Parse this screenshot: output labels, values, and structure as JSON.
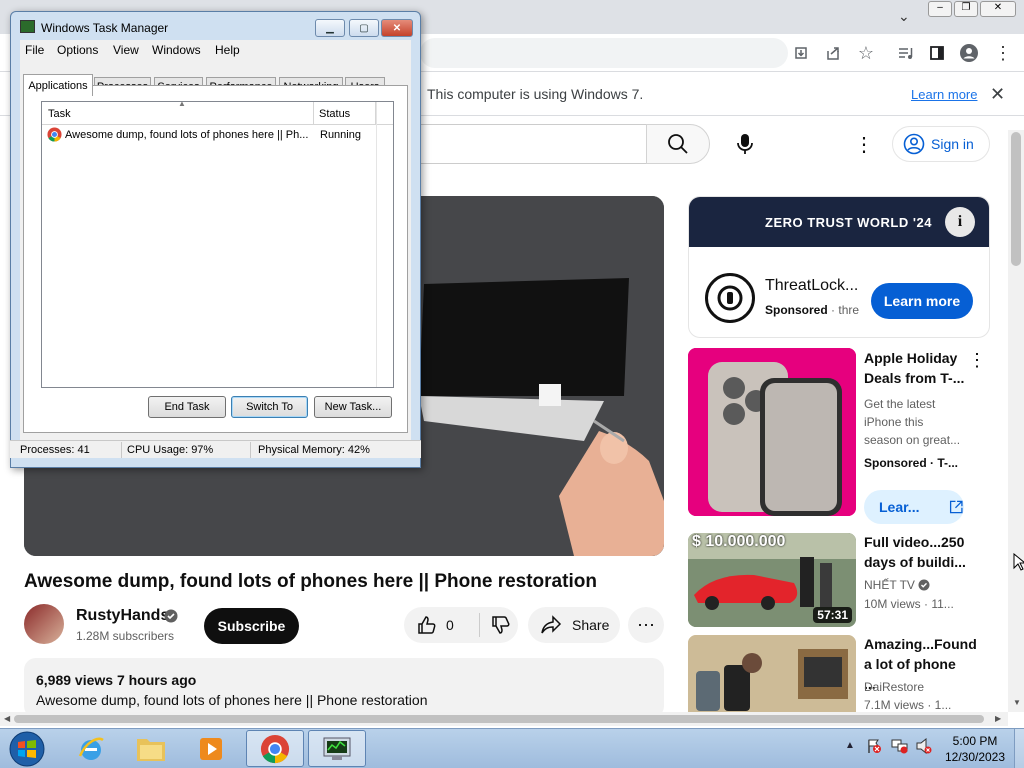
{
  "infobar": {
    "message": "This computer is using Windows 7.",
    "learn_more": "Learn more"
  },
  "yt_header": {
    "signin": "Sign in"
  },
  "video": {
    "title": "Awesome dump, found lots of phones here || Phone restoration",
    "channel": "RustyHands",
    "subscribers": "1.28M subscribers",
    "subscribe": "Subscribe",
    "likes": "0",
    "share": "Share",
    "views_time": "6,989 views  7 hours ago",
    "description": "Awesome dump, found lots of phones here || Phone restoration"
  },
  "ad": {
    "banner": "ZERO TRUST WORLD '24",
    "name": "ThreatLock...",
    "sponsored": "Sponsored",
    "sponsor_domain": "thre",
    "cta": "Learn more"
  },
  "recs": [
    {
      "title": "Apple Holiday Deals from T-...",
      "desc": "Get the latest iPhone this season on great...",
      "meta": "Sponsored · T-...",
      "cta": "Lear..."
    },
    {
      "title": "Full video...250 days of buildi...",
      "channel": "NHẾT TV",
      "meta": "10M views · 11...",
      "duration": "57:31",
      "overlay": "$ 10.000.000"
    },
    {
      "title": "Amazing...Found a lot of phone ...",
      "channel": "DaiRestore",
      "meta": "7.1M views · 1..."
    }
  ],
  "task_manager": {
    "title": "Windows Task Manager",
    "menu": [
      "File",
      "Options",
      "View",
      "Windows",
      "Help"
    ],
    "tabs": [
      "Applications",
      "Processes",
      "Services",
      "Performance",
      "Networking",
      "Users"
    ],
    "columns": [
      "Task",
      "Status"
    ],
    "rows": [
      {
        "task": "Awesome dump, found lots of phones here || Ph...",
        "status": "Running"
      }
    ],
    "buttons": {
      "end_task": "End Task",
      "switch_to": "Switch To",
      "new_task": "New Task..."
    },
    "status": {
      "processes": "Processes: 41",
      "cpu": "CPU Usage: 97%",
      "memory": "Physical Memory: 42%"
    }
  },
  "taskbar": {
    "time": "5:00 PM",
    "date": "12/30/2023"
  },
  "colors": {
    "accent": "#065fd4",
    "taskbar": "#b9d1ea"
  }
}
